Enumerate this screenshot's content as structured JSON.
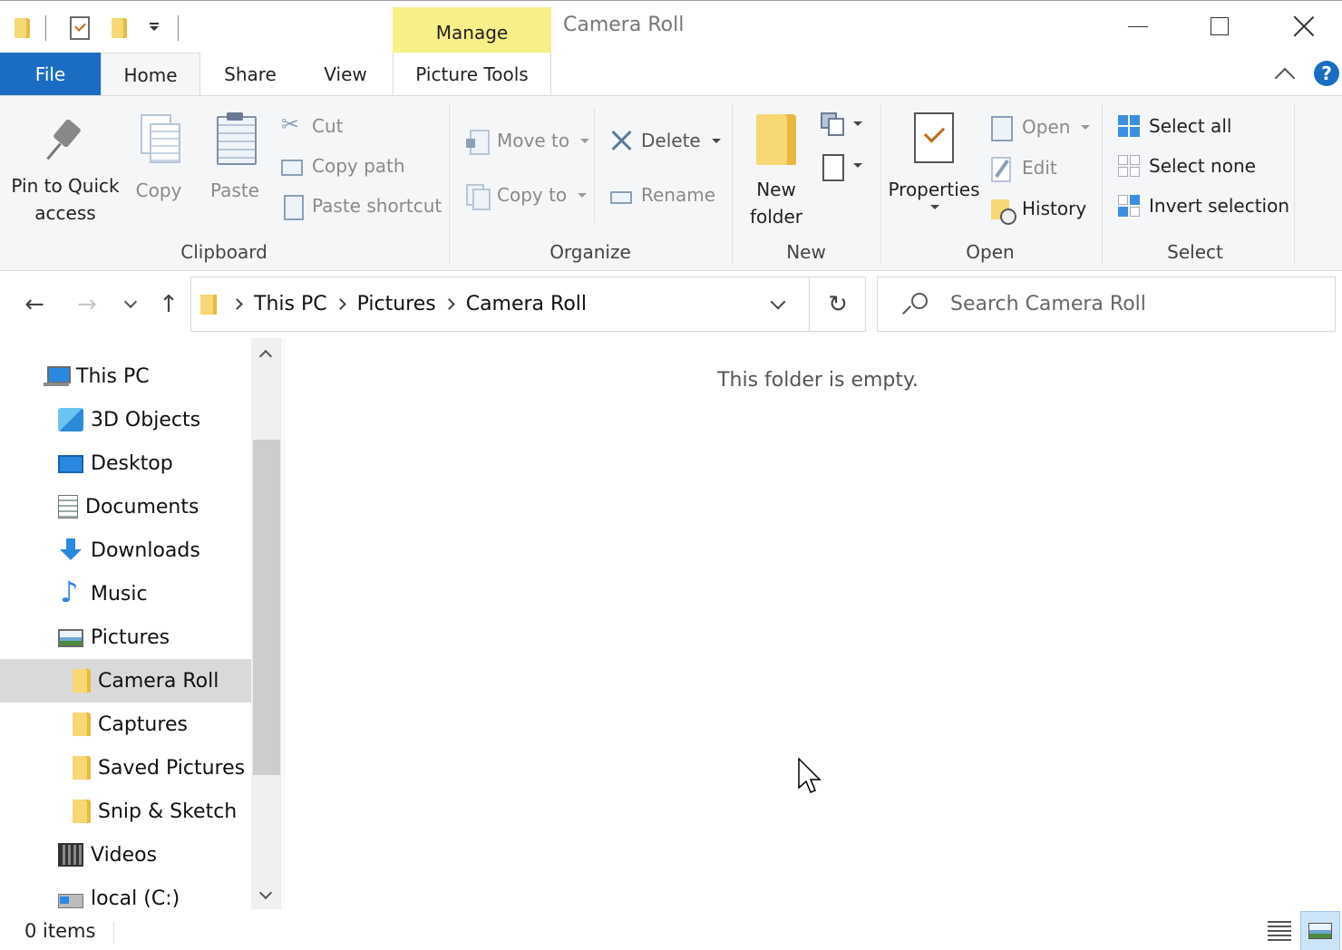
{
  "window": {
    "title": "Camera Roll",
    "context_tab_group": "Manage"
  },
  "ribbon_tabs": {
    "file": "File",
    "home": "Home",
    "share": "Share",
    "view": "View",
    "picture_tools": "Picture Tools",
    "help": "?"
  },
  "ribbon": {
    "clipboard": {
      "label": "Clipboard",
      "pin_line1": "Pin to Quick",
      "pin_line2": "access",
      "copy": "Copy",
      "paste": "Paste",
      "cut": "Cut",
      "copy_path": "Copy path",
      "paste_shortcut": "Paste shortcut"
    },
    "organize": {
      "label": "Organize",
      "move_to": "Move to",
      "copy_to": "Copy to",
      "delete": "Delete",
      "rename": "Rename"
    },
    "new": {
      "label": "New",
      "new_folder_line1": "New",
      "new_folder_line2": "folder"
    },
    "open": {
      "label": "Open",
      "properties": "Properties",
      "open": "Open",
      "edit": "Edit",
      "history": "History"
    },
    "select": {
      "label": "Select",
      "select_all": "Select all",
      "select_none": "Select none",
      "invert_selection": "Invert selection"
    }
  },
  "address": {
    "crumbs": [
      "This PC",
      "Pictures",
      "Camera Roll"
    ],
    "search_placeholder": "Search Camera Roll"
  },
  "nav_pane": {
    "items": [
      {
        "label": "This PC",
        "icon": "computer-icon",
        "level": 0
      },
      {
        "label": "3D Objects",
        "icon": "3d-objects-icon",
        "level": 1
      },
      {
        "label": "Desktop",
        "icon": "desktop-icon",
        "level": 1
      },
      {
        "label": "Documents",
        "icon": "documents-icon",
        "level": 1
      },
      {
        "label": "Downloads",
        "icon": "downloads-icon",
        "level": 1
      },
      {
        "label": "Music",
        "icon": "music-icon",
        "level": 1
      },
      {
        "label": "Pictures",
        "icon": "pictures-icon",
        "level": 1
      },
      {
        "label": "Camera Roll",
        "icon": "folder-icon",
        "level": 2,
        "selected": true
      },
      {
        "label": "Captures",
        "icon": "folder-icon",
        "level": 2
      },
      {
        "label": "Saved Pictures",
        "icon": "folder-icon",
        "level": 2
      },
      {
        "label": "Snip & Sketch",
        "icon": "folder-icon",
        "level": 2
      },
      {
        "label": "Videos",
        "icon": "videos-icon",
        "level": 1
      },
      {
        "label": "local (C:)",
        "icon": "drive-icon",
        "level": 1
      }
    ]
  },
  "content": {
    "empty_message": "This folder is empty."
  },
  "status": {
    "item_count": "0 items"
  },
  "colors": {
    "file_tab": "#1a6dc2",
    "manage_tab": "#f7ef87",
    "ribbon_bg": "#f5f6f7",
    "selected_nav": "#d9d9d9",
    "folder": "#f8d775"
  }
}
